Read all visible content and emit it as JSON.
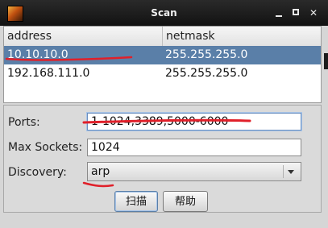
{
  "window": {
    "title": "Scan"
  },
  "table": {
    "columns": [
      "address",
      "netmask"
    ],
    "rows": [
      {
        "address": "10.10.10.0",
        "netmask": "255.255.255.0",
        "selected": true
      },
      {
        "address": "192.168.111.0",
        "netmask": "255.255.255.0",
        "selected": false
      }
    ]
  },
  "form": {
    "ports": {
      "label": "Ports:",
      "value": "1-1024,3389,5000-6000"
    },
    "max_sockets": {
      "label": "Max Sockets:",
      "value": "1024"
    },
    "discovery": {
      "label": "Discovery:",
      "value": "arp"
    }
  },
  "buttons": {
    "scan": "扫描",
    "help": "帮助"
  },
  "colors": {
    "selection": "#5a7fa8",
    "annotation": "#e0202a"
  }
}
